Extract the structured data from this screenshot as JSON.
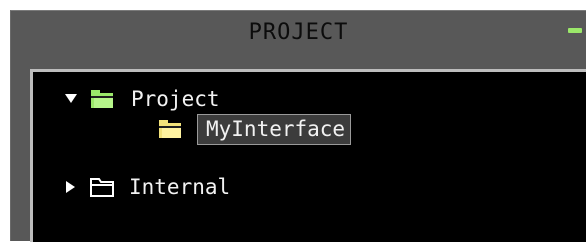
{
  "panel": {
    "title": "PROJECT",
    "collapse_icon": "minus-icon",
    "accent_color": "#9be86a"
  },
  "tree": {
    "items": [
      {
        "label": "Project",
        "state": "expanded",
        "icon": "folder-open-icon",
        "folder_color": "#9be86a",
        "level": 0
      },
      {
        "label": "MyInterface",
        "state": "leaf",
        "icon": "folder-open-icon",
        "folder_color": "#f2e27a",
        "level": 1,
        "selected": true
      },
      {
        "label": "Internal",
        "state": "collapsed",
        "icon": "folder-outline-icon",
        "folder_color": "#ffffff",
        "level": 0
      }
    ]
  }
}
